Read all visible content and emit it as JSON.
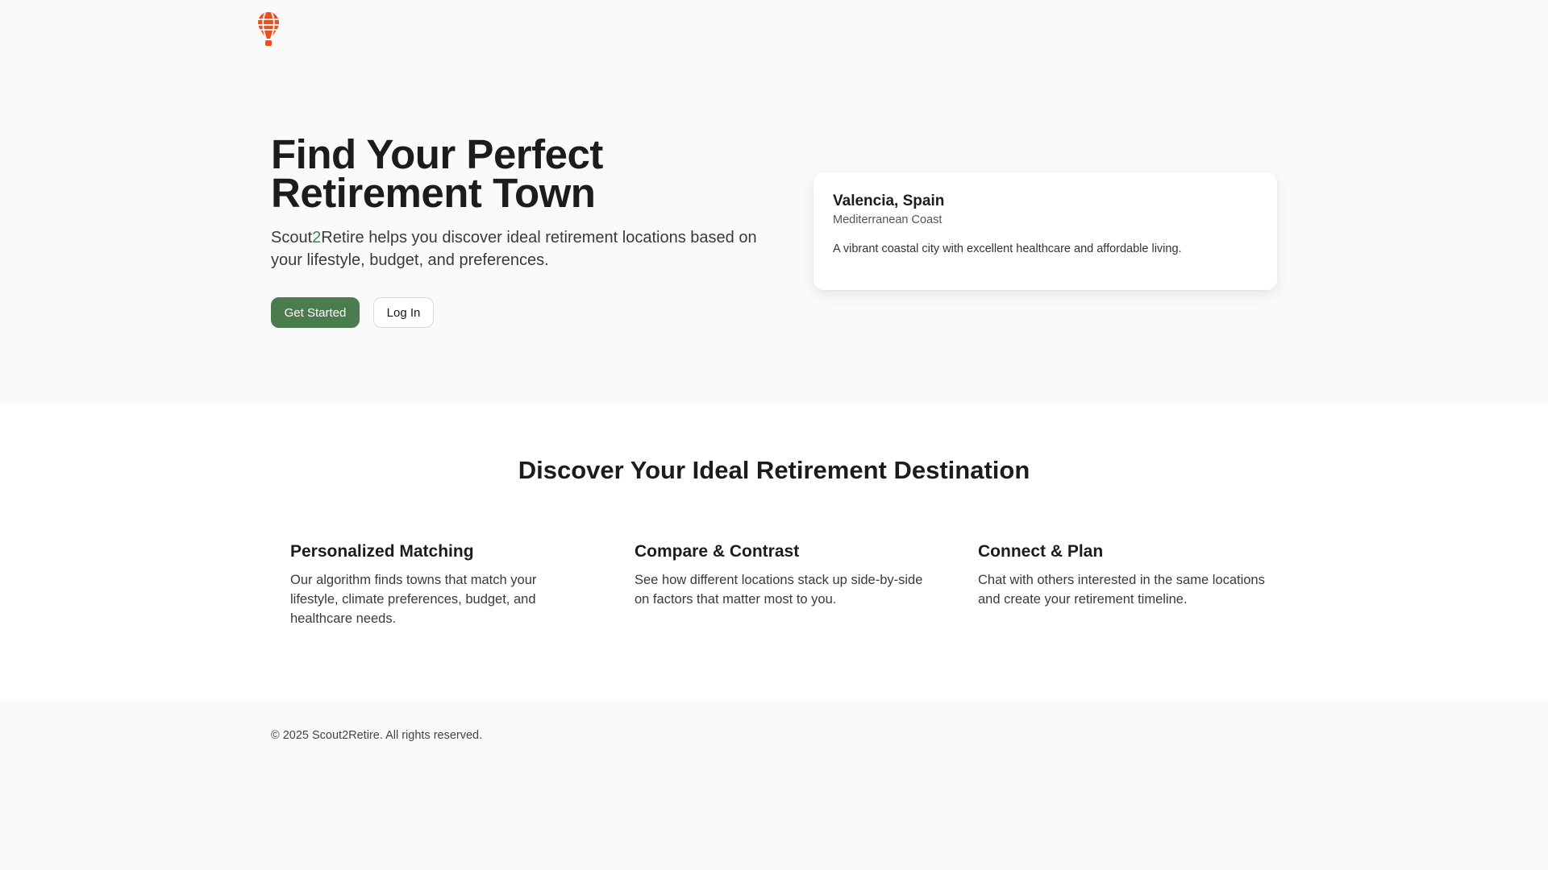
{
  "header": {
    "logo_icon": "hot-air-balloon-icon",
    "logo_color": "#e8501e"
  },
  "hero": {
    "title_line1": "Find Your Perfect",
    "title_line2": "Retirement Town",
    "subtitle_prefix": "Scout",
    "subtitle_two": "2",
    "subtitle_rest": "Retire helps you discover ideal retirement locations based on your lifestyle, budget, and preferences.",
    "get_started_label": "Get Started",
    "login_label": "Log In",
    "accent_color": "#4a7c4e"
  },
  "town_card": {
    "name": "Valencia, Spain",
    "region": "Mediterranean Coast",
    "description": "A vibrant coastal city with excellent healthcare and affordable living."
  },
  "features": {
    "title": "Discover Your Ideal Retirement Destination",
    "items": [
      {
        "title": "Personalized Matching",
        "description": "Our algorithm finds towns that match your lifestyle, climate preferences, budget, and healthcare needs."
      },
      {
        "title": "Compare & Contrast",
        "description": "See how different locations stack up side-by-side on factors that matter most to you."
      },
      {
        "title": "Connect & Plan",
        "description": "Chat with others interested in the same locations and create your retirement timeline."
      }
    ]
  },
  "footer": {
    "copyright": "© 2025 Scout2Retire. All rights reserved."
  }
}
